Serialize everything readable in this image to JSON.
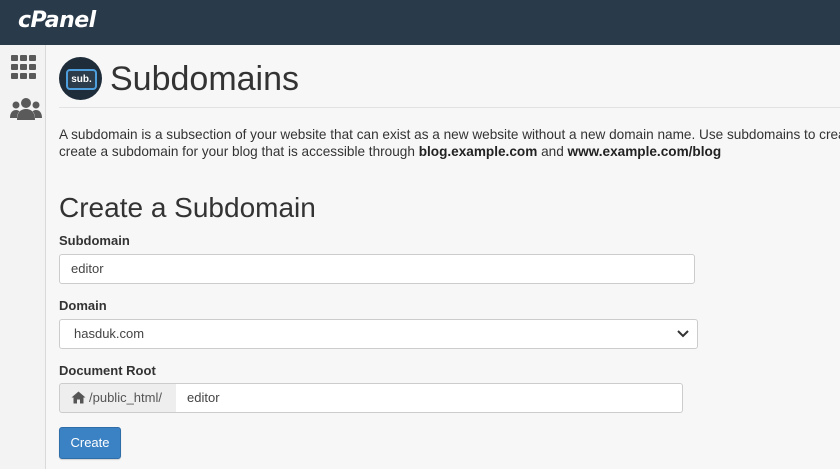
{
  "brand": {
    "logo_text": "cPanel"
  },
  "sidebar": {
    "items": [
      {
        "icon": "grid-icon"
      },
      {
        "icon": "users-icon"
      }
    ]
  },
  "page": {
    "icon_text": "sub.",
    "title": "Subdomains",
    "description": {
      "line1": "A subdomain is a subsection of your website that can exist as a new website without a new domain name. Use subdomains to create",
      "line2_before": "create a subdomain for your blog that is accessible through ",
      "line2_bold1": "blog.example.com",
      "line2_mid": " and ",
      "line2_bold2": "www.example.com/blog"
    }
  },
  "form": {
    "section_title": "Create a Subdomain",
    "subdomain": {
      "label": "Subdomain",
      "value": "editor"
    },
    "domain": {
      "label": "Domain",
      "selected": "hasduk.com"
    },
    "document_root": {
      "label": "Document Root",
      "prefix": "/public_html/",
      "value": "editor"
    },
    "create_label": "Create"
  },
  "colors": {
    "topbar": "#293a4a",
    "button": "#3b82c4",
    "icon_accent": "#4e9fde"
  }
}
